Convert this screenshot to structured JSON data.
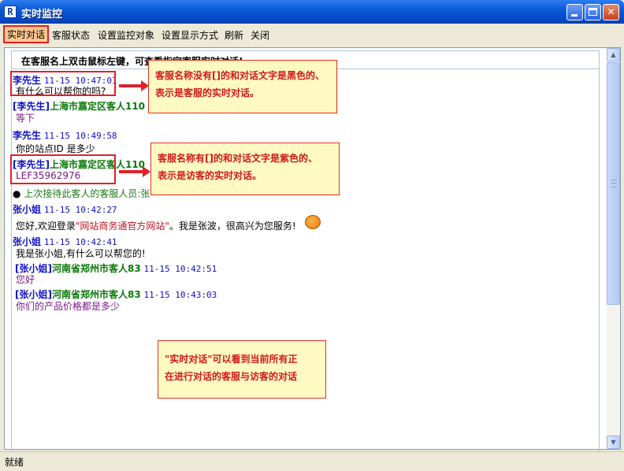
{
  "window": {
    "title": "实时监控",
    "app_icon_glyph": "R"
  },
  "menu": [
    "实时对话",
    "客服状态",
    "设置监控对象",
    "设置显示方式",
    "刷新",
    "关闭"
  ],
  "hint": "在客服名上双击鼠标左键，可查看指定客服实时对话!",
  "messages": [
    {
      "name": "李先生",
      "time": "11-15 10:47:01",
      "text": "有什么可以帮你的吗?"
    },
    {
      "name": "[李先生]",
      "visitor": "上海市嘉定区客人110",
      "text": "等下"
    },
    {
      "name": "李先生",
      "time": "11-15 10:49:58",
      "text": "你的站点ID 是多少"
    },
    {
      "name": "[李先生]",
      "visitor": "上海市嘉定区客人110",
      "text": "LEF35962976"
    },
    {
      "notice": "上次接待此客人的客服人员:张"
    },
    {
      "name": "张小姐",
      "time": "11-15 10:42:27",
      "text_pre": "您好,欢迎登录",
      "link": "\"网站商务通官方网站\"",
      "text_post": "。我是张波，很高兴为您服务!"
    },
    {
      "name": "张小姐",
      "time": "11-15 10:42:41",
      "text": "我是张小姐,有什么可以帮您的!"
    },
    {
      "name": "[张小姐]",
      "visitor": "河南省郑州市客人83",
      "time": "11-15 10:42:51",
      "text": "您好"
    },
    {
      "name": "[张小姐]",
      "visitor": "河南省郑州市客人83",
      "time": "11-15 10:43:03",
      "text": "你们的产品价格都是多少"
    }
  ],
  "callouts": {
    "agent": [
      "客服名称没有[]的和对话文字是黑色的、",
      "表示是客服的实时对话。"
    ],
    "visitor": [
      "客服名称有[]的和对话文字是紫色的、",
      "表示是访客的实时对话。"
    ],
    "realtime": [
      "\"实时对话\"可以看到当前所有正",
      "在进行对话的客服与访客的对话"
    ]
  },
  "status": "就绪",
  "colors": {
    "agent_name": "#1010c8",
    "visitor_name": "#0a7a0a",
    "visitor_text": "#7a1a8a",
    "callout_text": "#d11a1a",
    "highlight": "#e0202a"
  }
}
